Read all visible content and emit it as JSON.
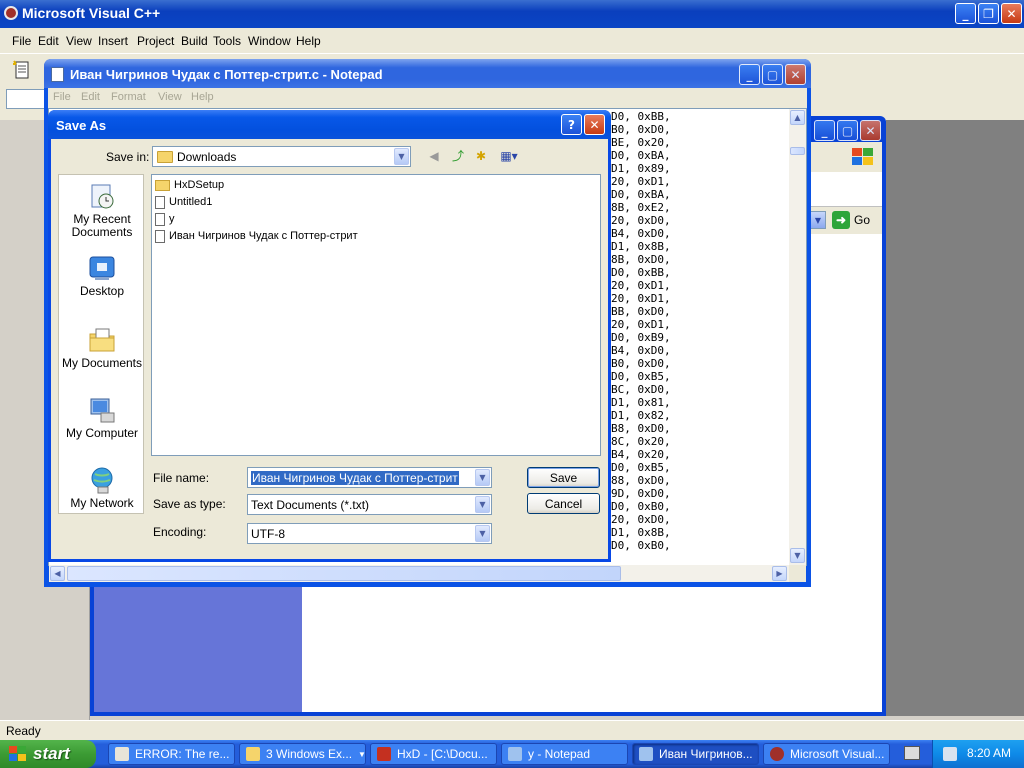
{
  "vc": {
    "title": "Microsoft Visual C++",
    "menu": [
      "File",
      "Edit",
      "View",
      "Insert",
      "Project",
      "Build",
      "Tools",
      "Window",
      "Help"
    ],
    "status": "Ready"
  },
  "bg_window": {
    "go_label": "Go"
  },
  "notepad": {
    "title": "Иван Чигринов Чудак с Поттер-стрит.c - Notepad",
    "menu": [
      "File",
      "Edit",
      "Format",
      "View",
      "Help"
    ],
    "code_lines": [
      "D0, 0xBB,",
      "B0, 0xD0,",
      "BE, 0x20,",
      "D0, 0xBA,",
      "D1, 0x89,",
      "20, 0xD1,",
      "D0, 0xBA,",
      "8B, 0xE2,",
      "20, 0xD0,",
      "B4, 0xD0,",
      "D1, 0x8B,",
      "8B, 0xD0,",
      "D0, 0xBB,",
      "20, 0xD1,",
      "20, 0xD1,",
      "BB, 0xD0,",
      "20, 0xD1,",
      "D0, 0xB9,",
      "B4, 0xD0,",
      "B0, 0xD0,",
      "D0, 0xB5,",
      "BC, 0xD0,",
      "D1, 0x81,",
      "D1, 0x82,",
      "B8, 0xD0,",
      "8C, 0x20,",
      "B4, 0x20,",
      "D0, 0xB5,",
      "88, 0xD0,",
      "9D, 0xD0,",
      "D0, 0xB0,",
      "20, 0xD0,",
      "D1, 0x8B,",
      "D0, 0xB0,"
    ]
  },
  "dialog": {
    "title": "Save As",
    "help_label": "?",
    "save_in_label": "Save in:",
    "save_in_value": "Downloads",
    "places": [
      "My Recent\nDocuments",
      "Desktop",
      "My Documents",
      "My Computer",
      "My Network"
    ],
    "files": [
      {
        "name": "HxDSetup",
        "type": "folder"
      },
      {
        "name": "Untitled1",
        "type": "text"
      },
      {
        "name": "у",
        "type": "text"
      },
      {
        "name": "Иван Чигринов Чудак с Поттер-стрит",
        "type": "text"
      }
    ],
    "file_name_label": "File name:",
    "file_name_value": "Иван Чигринов Чудак с Поттер-стрит",
    "save_as_type_label": "Save as type:",
    "save_as_type_value": "Text Documents (*.txt)",
    "encoding_label": "Encoding:",
    "encoding_value": "UTF-8",
    "save_button": "Save",
    "cancel_button": "Cancel"
  },
  "taskbar": {
    "start": "start",
    "tasks": [
      "ERROR: The re...",
      "3 Windows Ex...",
      "HxD - [C:\\Docu...",
      "у - Notepad",
      "Иван Чигринов...",
      "Microsoft Visual..."
    ],
    "clock": "8:20 AM"
  },
  "colors": {
    "title_active": "#0a52db",
    "taskbar": "#245edb",
    "start_green": "#3c9b34",
    "selection": "#316ac5"
  }
}
